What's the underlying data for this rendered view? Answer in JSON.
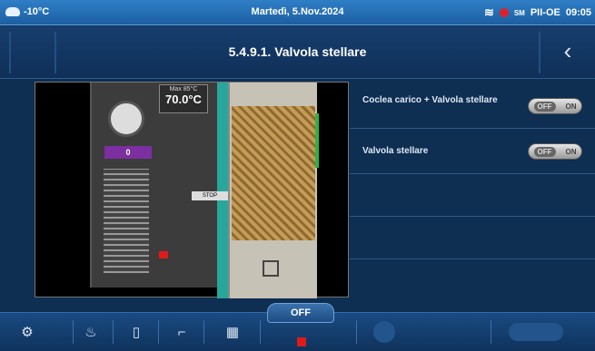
{
  "status": {
    "outdoor_temp": "-10°C",
    "date": "Martedì, 5.Nov.2024",
    "sm_label": "SM",
    "profile": "PII-OE",
    "time": "09:05"
  },
  "header": {
    "title": "5.4.9.1. Valvola stellare"
  },
  "diagram": {
    "temp_label": "Max 85°C",
    "temp_value": "70.0°C",
    "counter": "0",
    "tag": "STOP"
  },
  "settings": {
    "items": [
      {
        "label": "Coclea carico + Valvola stellare",
        "toggle_off": "OFF",
        "toggle_on": "ON"
      },
      {
        "label": "Valvola stellare",
        "toggle_off": "OFF",
        "toggle_on": "ON"
      }
    ]
  },
  "bottom": {
    "off_label": "OFF"
  }
}
